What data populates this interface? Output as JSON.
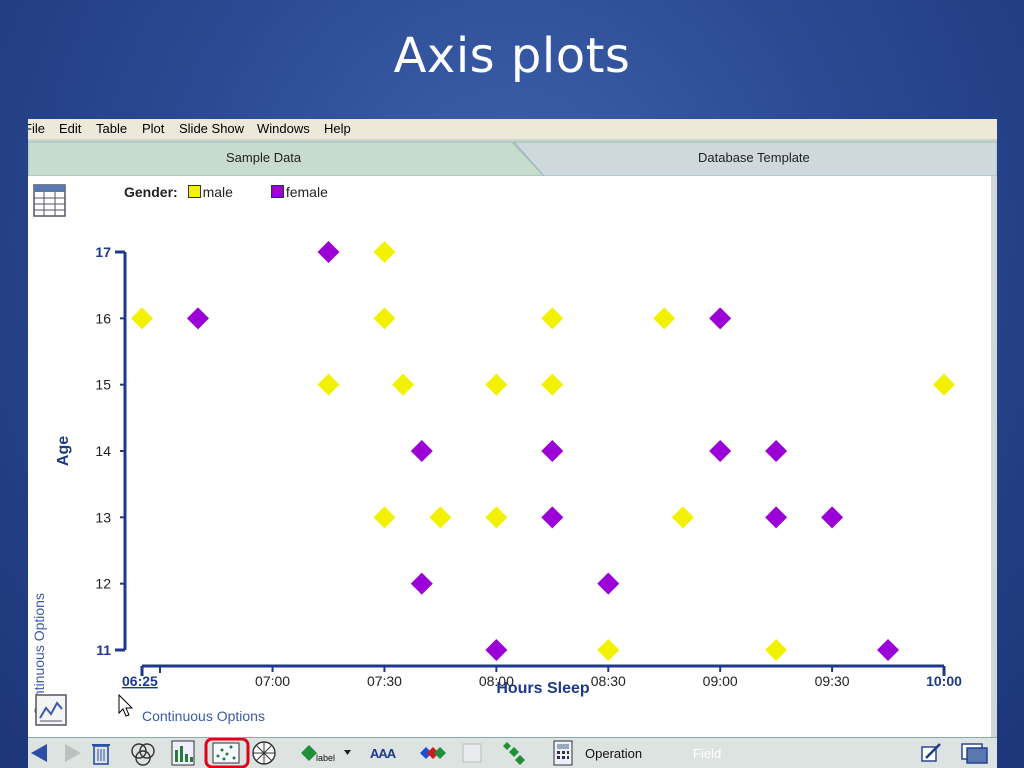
{
  "slide": {
    "title": "Axis plots"
  },
  "menu": {
    "items": [
      "File",
      "Edit",
      "Table",
      "Plot",
      "Slide Show",
      "Windows",
      "Help"
    ]
  },
  "tabs": [
    {
      "label": "Sample Data",
      "active": true
    },
    {
      "label": "Database Template",
      "active": false
    }
  ],
  "legend": {
    "title": "Gender:",
    "items": [
      {
        "label": "male",
        "color": "#f2f200"
      },
      {
        "label": "female",
        "color": "#9b00d6"
      }
    ]
  },
  "options": {
    "vertical": "Continuous  Options",
    "horizontal": "Continuous  Options"
  },
  "chart_data": {
    "type": "scatter",
    "xlabel": "Hours Sleep",
    "ylabel": "Age",
    "x_ticks": [
      "06:25",
      "07:00",
      "07:30",
      "08:00",
      "08:30",
      "09:00",
      "09:30",
      "10:00"
    ],
    "x_tick_minutes": [
      385,
      420,
      450,
      480,
      510,
      540,
      570,
      600
    ],
    "xlim_minutes": [
      385,
      600
    ],
    "y_ticks": [
      "11",
      "12",
      "13",
      "14",
      "15",
      "16",
      "17"
    ],
    "ylim": [
      11,
      17
    ],
    "series": [
      {
        "name": "male",
        "color": "#f2f200",
        "points": [
          [
            "06:25",
            16
          ],
          [
            "07:15",
            15
          ],
          [
            "07:30",
            17
          ],
          [
            "07:30",
            16
          ],
          [
            "07:35",
            15
          ],
          [
            "08:00",
            15
          ],
          [
            "08:15",
            16
          ],
          [
            "08:15",
            15
          ],
          [
            "08:45",
            16
          ],
          [
            "10:00",
            15
          ],
          [
            "07:30",
            13
          ],
          [
            "07:45",
            13
          ],
          [
            "08:00",
            13
          ],
          [
            "08:50",
            13
          ],
          [
            "08:30",
            11
          ],
          [
            "09:15",
            11
          ]
        ]
      },
      {
        "name": "female",
        "color": "#9b00d6",
        "points": [
          [
            "07:15",
            17
          ],
          [
            "06:40",
            16
          ],
          [
            "09:00",
            16
          ],
          [
            "07:40",
            14
          ],
          [
            "08:15",
            14
          ],
          [
            "09:00",
            14
          ],
          [
            "09:15",
            14
          ],
          [
            "08:15",
            13
          ],
          [
            "09:15",
            13
          ],
          [
            "09:30",
            13
          ],
          [
            "07:40",
            12
          ],
          [
            "08:30",
            12
          ],
          [
            "08:00",
            11
          ],
          [
            "09:45",
            11
          ]
        ]
      }
    ]
  },
  "toolbar": {
    "operation_label": "Operation",
    "field_label": "Field",
    "label_button": "label",
    "font_button": "AAA"
  }
}
